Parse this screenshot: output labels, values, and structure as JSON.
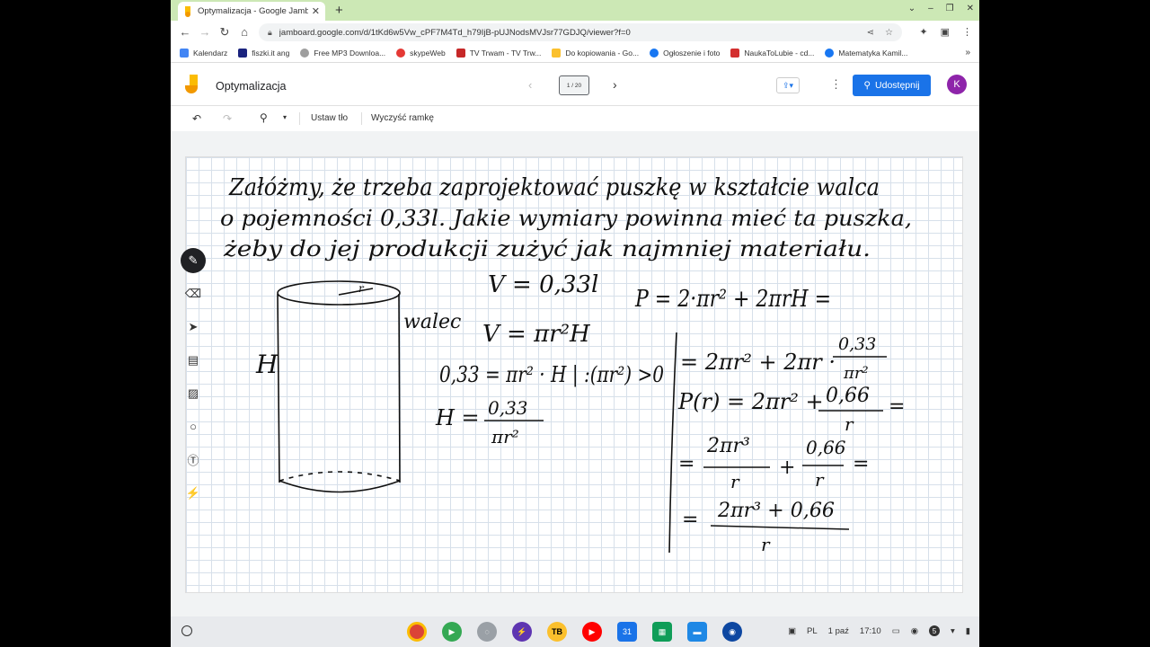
{
  "browser": {
    "tab_title": "Optymalizacja - Google Jamboa",
    "tab_close": "✕",
    "new_tab": "+",
    "window_controls": [
      "⌄",
      "–",
      "❐",
      "✕"
    ],
    "url": "jamboard.google.com/d/1tKd6w5Vw_cPF7M4Td_h79IjB-pUJNodsMVJsr77GDJQ/viewer?f=0",
    "bookmarks": [
      {
        "label": "Kalendarz",
        "color": "#4285f4"
      },
      {
        "label": "fiszki.it ang",
        "color": "#1a237e"
      },
      {
        "label": "Free MP3 Downloa...",
        "color": "#9e9e9e"
      },
      {
        "label": "skypeWeb",
        "color": "#e53935"
      },
      {
        "label": "TV Trwam - TV Trw...",
        "color": "#c62828"
      },
      {
        "label": "Do kopiowania - Go...",
        "color": "#fbc02d"
      },
      {
        "label": "Ogłoszenie i foto",
        "color": "#1877f2"
      },
      {
        "label": "NaukaToLubie - cd...",
        "color": "#d32f2f"
      },
      {
        "label": "Matematyka Kamil...",
        "color": "#1877f2"
      }
    ],
    "bookmarks_more": "»"
  },
  "jamboard": {
    "title": "Optymalizacja",
    "frame_indicator": "1 / 20",
    "share_label": "Udostępnij",
    "avatar_letter": "K",
    "set_background": "Ustaw tło",
    "clear_frame": "Wyczyść ramkę",
    "brand_color": "#1a73e8"
  },
  "board_text": {
    "line1": "Załóżmy, że trzeba zaprojektować puszkę w kształcie walca",
    "line2": "o pojemności 0,33l. Jakie wymiary powinna mieć ta puszka,",
    "line3": "żeby do jej produkcji zużyć jak najmniej materiału.",
    "walec": "walec",
    "H": "H",
    "r": "r",
    "v1": "V = 0,33l",
    "v2": "V = πr²H",
    "eq1": "0,33 = πr² · H | :(πr²) >0",
    "eq2_lhs": "H =",
    "eq2_num": "0,33",
    "eq2_den": "πr²",
    "p1": "P = 2·πr² + 2πrH =",
    "p2": "= 2πr² + 2πr ·",
    "p2_num": "0,33",
    "p2_den": "πr²",
    "p3": "P(r) = 2πr² +",
    "p3_num": "0,66",
    "p3_den": "r",
    "p4_num1": "2πr³",
    "p4_den1": "r",
    "p4_num2": "0,66",
    "p4_den2": "r",
    "p5_num": "2πr³ + 0,66",
    "p5_den": "r"
  },
  "shelf": {
    "language": "PL",
    "date": "1 paź",
    "time": "17:10",
    "notifications": "5",
    "apps": [
      {
        "name": "chrome",
        "color": "#db4437"
      },
      {
        "name": "play-store",
        "color": "#34a853"
      },
      {
        "name": "messages",
        "color": "#9aa0a6"
      },
      {
        "name": "app-purple",
        "color": "#5e35b1"
      },
      {
        "name": "tb",
        "color": "#fbc02d"
      },
      {
        "name": "youtube",
        "color": "#ff0000"
      },
      {
        "name": "calendar",
        "color": "#1a73e8"
      },
      {
        "name": "sheets",
        "color": "#0f9d58"
      },
      {
        "name": "files",
        "color": "#1e88e5"
      },
      {
        "name": "app-dark",
        "color": "#0d47a1"
      }
    ]
  }
}
